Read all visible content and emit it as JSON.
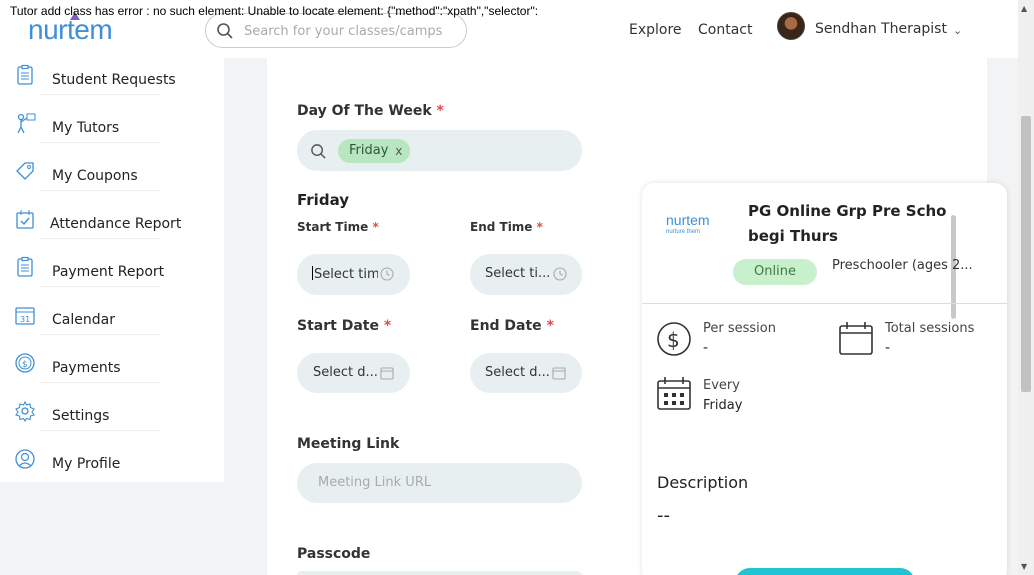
{
  "error_banner": "Tutor add class has error : no such element: Unable to locate element: {\"method\":\"xpath\",\"selector\":",
  "header": {
    "logo_text": "nurtem",
    "search_placeholder": "Search for your classes/camps",
    "nav": [
      "Explore",
      "Contact"
    ],
    "user_name": "Sendhan Therapist",
    "caret": "⌄"
  },
  "sidebar": {
    "items": [
      {
        "label": "Student Requests",
        "icon": "clipboard-icon"
      },
      {
        "label": "My Tutors",
        "icon": "tutor-icon"
      },
      {
        "label": "My Coupons",
        "icon": "tag-icon"
      },
      {
        "label": "Attendance Report",
        "icon": "calendar-check-icon"
      },
      {
        "label": "Payment Report",
        "icon": "clipboard-icon"
      },
      {
        "label": "Calendar",
        "icon": "calendar-icon"
      },
      {
        "label": "Payments",
        "icon": "dollar-icon"
      },
      {
        "label": "Settings",
        "icon": "gear-icon"
      },
      {
        "label": "My Profile",
        "icon": "profile-icon"
      }
    ]
  },
  "form": {
    "day_of_week_label": "Day Of The Week",
    "selected_day_tag": "Friday",
    "tag_remove": "x",
    "day_heading": "Friday",
    "start_time_label": "Start Time",
    "end_time_label": "End Time",
    "start_time_placeholder": "Select time",
    "end_time_placeholder": "Select ti...",
    "start_date_label": "Start Date",
    "end_date_label": "End Date",
    "start_date_placeholder": "Select d...",
    "end_date_placeholder": "Select d...",
    "meeting_link_label": "Meeting Link",
    "meeting_link_placeholder": "Meeting Link URL",
    "passcode_label": "Passcode",
    "required_mark": "*"
  },
  "preview": {
    "logo_text": "nurtem",
    "logo_tagline": "nurture them",
    "title": "PG Online Grp Pre Scho begi Thurs",
    "mode_badge": "Online",
    "age_group": "Preschooler (ages 2...",
    "per_session_label": "Per session",
    "per_session_value": "-",
    "total_sessions_label": "Total sessions",
    "total_sessions_value": "-",
    "every_label": "Every",
    "every_value": "Friday",
    "description_label": "Description",
    "description_value": "--"
  },
  "colors": {
    "brand_blue": "#3f8fd6",
    "tag_green": "#b7e6c0",
    "input_bg": "#e8eff1",
    "required_red": "#e04a4a",
    "cta_teal": "#1fc4d2"
  }
}
